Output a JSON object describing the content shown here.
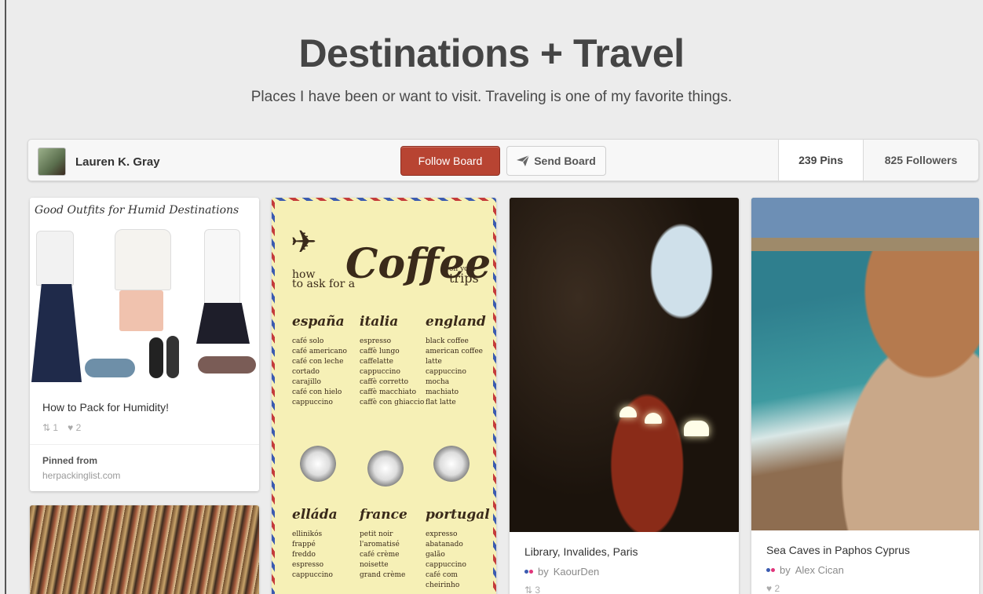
{
  "board": {
    "title": "Destinations + Travel",
    "description": "Places I have been or want to visit. Traveling is one of my favorite things."
  },
  "toolbar": {
    "owner_name": "Lauren K. Gray",
    "follow_label": "Follow Board",
    "send_label": "Send Board",
    "pins_count": "239 Pins",
    "followers_count": "825 Followers"
  },
  "pins": [
    {
      "image_caption": "Good Outfits for Humid Destinations",
      "description": "How to Pack for Humidity!",
      "repins": "1",
      "likes": "2",
      "pinned_from_label": "Pinned from",
      "source": "herpackinglist.com"
    },
    {
      "image_text": {
        "how": "how",
        "to_ask": "to ask for a",
        "coffee": "Coffee",
        "on_your": "on your",
        "trips": "trips",
        "columns": [
          {
            "heading": "españa",
            "items": [
              "café solo",
              "café americano",
              "café con leche",
              "cortado",
              "carajillo",
              "café con hielo",
              "cappuccino"
            ]
          },
          {
            "heading": "italia",
            "items": [
              "espresso",
              "caffè lungo",
              "caffelatte",
              "cappuccino",
              "caffè corretto",
              "caffè macchiato",
              "caffè con ghiaccio"
            ]
          },
          {
            "heading": "england",
            "items": [
              "black coffee",
              "american coffee",
              "latte",
              "cappuccino",
              "mocha",
              "machiato",
              "flat latte"
            ]
          },
          {
            "heading": "elláda",
            "items": [
              "ellinikós",
              "frappé",
              "freddo",
              "espresso",
              "cappuccino"
            ]
          },
          {
            "heading": "france",
            "items": [
              "petit noir",
              "l'aromatisé",
              "café crème",
              "noisette",
              "grand crème"
            ]
          },
          {
            "heading": "portugal",
            "items": [
              "expresso",
              "abatanado",
              "galão",
              "cappuccino",
              "café com cheirinho"
            ]
          }
        ]
      }
    },
    {
      "description": "Library, Invalides, Paris",
      "by_prefix": "by",
      "credit": "KaourDen",
      "repins": "3"
    },
    {
      "description": "Sea Caves in Paphos Cyprus",
      "by_prefix": "by",
      "credit": "Alex Cican",
      "likes": "2"
    }
  ],
  "colors": {
    "follow_button": "#b84432",
    "background": "#ececec",
    "flickr_blue": "#3b5bb0",
    "flickr_pink": "#e0357a"
  },
  "icons": {
    "send": "paper-plane-icon",
    "repin": "repin-icon",
    "like": "heart-icon",
    "credit": "flickr-icon"
  }
}
